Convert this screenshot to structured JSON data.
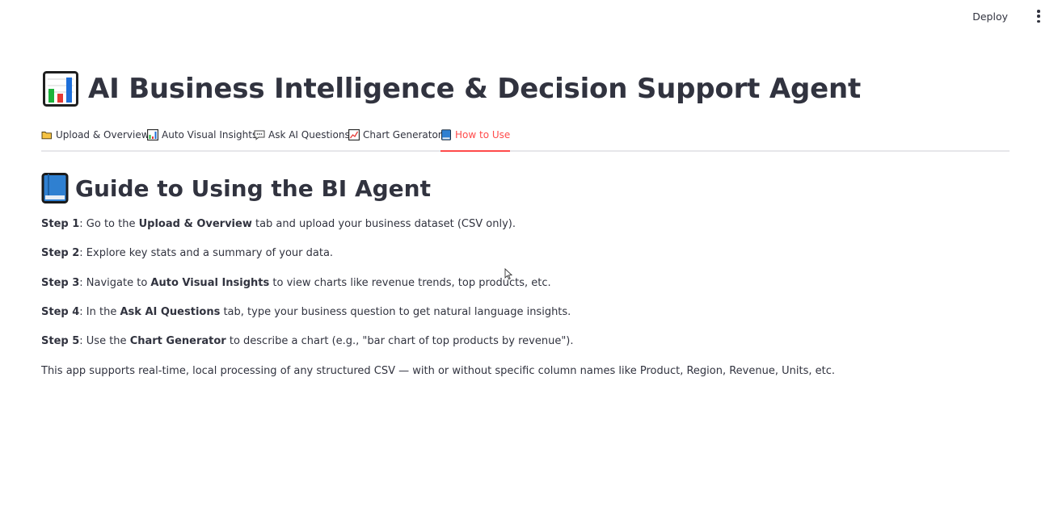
{
  "header": {
    "deploy_label": "Deploy",
    "menu_icon": "kebab-menu-icon"
  },
  "app": {
    "title": "AI Business Intelligence & Decision Support Agent",
    "title_icon": "bar-chart-icon"
  },
  "tabs": [
    {
      "label": "Upload & Overview",
      "icon": "folder-icon",
      "active": false
    },
    {
      "label": "Auto Visual Insights",
      "icon": "bar-chart-icon",
      "active": false
    },
    {
      "label": "Ask AI Questions",
      "icon": "speech-bubble-icon",
      "active": false
    },
    {
      "label": "Chart Generator",
      "icon": "line-chart-icon",
      "active": false
    },
    {
      "label": "How to Use",
      "icon": "blue-book-icon",
      "active": true
    }
  ],
  "guide": {
    "title": "Guide to Using the BI Agent",
    "icon": "blue-book-icon",
    "steps": [
      {
        "label": "Step 1",
        "t1": ": Go to the ",
        "b1": "Upload & Overview",
        "t2": " tab and upload your business dataset (CSV only)."
      },
      {
        "label": "Step 2",
        "t1": ": Explore key stats and a summary of your data.",
        "b1": "",
        "t2": ""
      },
      {
        "label": "Step 3",
        "t1": ": Navigate to ",
        "b1": "Auto Visual Insights",
        "t2": " to view charts like revenue trends, top products, etc."
      },
      {
        "label": "Step 4",
        "t1": ": In the ",
        "b1": "Ask AI Questions",
        "t2": " tab, type your business question to get natural language insights."
      },
      {
        "label": "Step 5",
        "t1": ": Use the ",
        "b1": "Chart Generator",
        "t2": " to describe a chart (e.g., \"bar chart of top products by revenue\")."
      }
    ],
    "note": "This app supports real-time, local processing of any structured CSV — with or without specific column names like Product, Region, Revenue, Units, etc."
  },
  "colors": {
    "accent": "#ff4b4b",
    "text": "#31333f",
    "divider": "#e6e6ea"
  }
}
